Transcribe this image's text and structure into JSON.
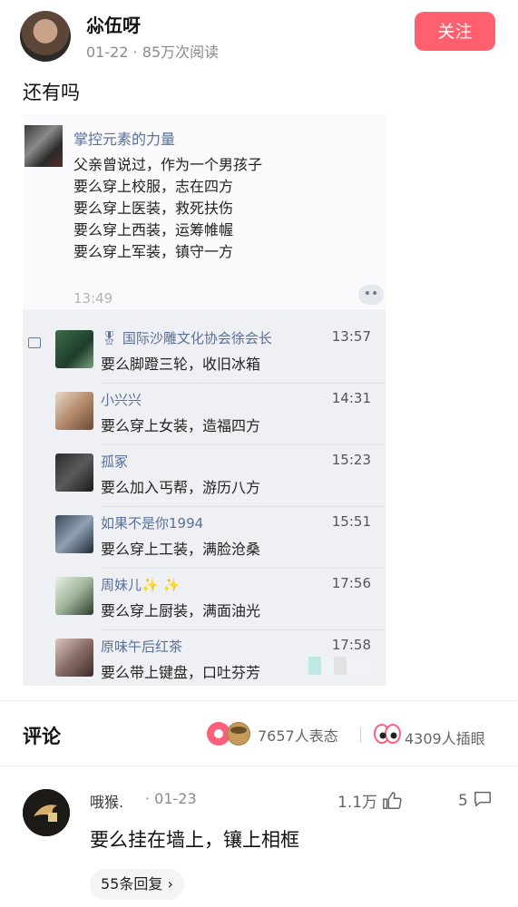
{
  "post": {
    "author": "尛伍呀",
    "date": "01-22",
    "views": "85万次阅读",
    "follow_label": "关注",
    "text": "还有吗"
  },
  "screenshot": {
    "card": {
      "name": "掌控元素的力量",
      "lines": [
        "父亲曾说过，作为一个男孩子",
        "要么穿上校服，志在四方",
        "要么穿上医装，救死扶伤",
        "要么穿上西装，运筹帷幄",
        "要么穿上军装，镇守一方"
      ],
      "time": "13:49",
      "more": "••"
    },
    "comments": [
      {
        "name": "国际沙雕文化协会徐会长",
        "time": "13:57",
        "text": "要么脚蹬三轮，收旧冰箱",
        "badge": "🎖"
      },
      {
        "name": "小兴兴",
        "time": "14:31",
        "text": "要么穿上女装，造福四方"
      },
      {
        "name": "孤冢",
        "time": "15:23",
        "text": "要么加入丐帮，游历八方"
      },
      {
        "name": "如果不是你1994",
        "time": "15:51",
        "text": "要么穿上工装，满脸沧桑"
      },
      {
        "name": "周妹儿✨ ✨",
        "time": "17:56",
        "text": "要么穿上厨装，满面油光"
      },
      {
        "name": "原味午后红茶",
        "time": "17:58",
        "text": "要么带上键盘，口吐芬芳"
      }
    ]
  },
  "comments_section": {
    "title": "评论",
    "reactions": "7657人表态",
    "eye_count": "4309人插眼"
  },
  "comment": {
    "name": "哦猴.",
    "date": "· 01-23",
    "likes": "1.1万",
    "reply_count": "5",
    "text": "要么挂在墙上，镶上相框",
    "replies_label": "55条回复 ›"
  },
  "colors": {
    "accent": "#ff5f6e",
    "link": "#5a6f99"
  }
}
